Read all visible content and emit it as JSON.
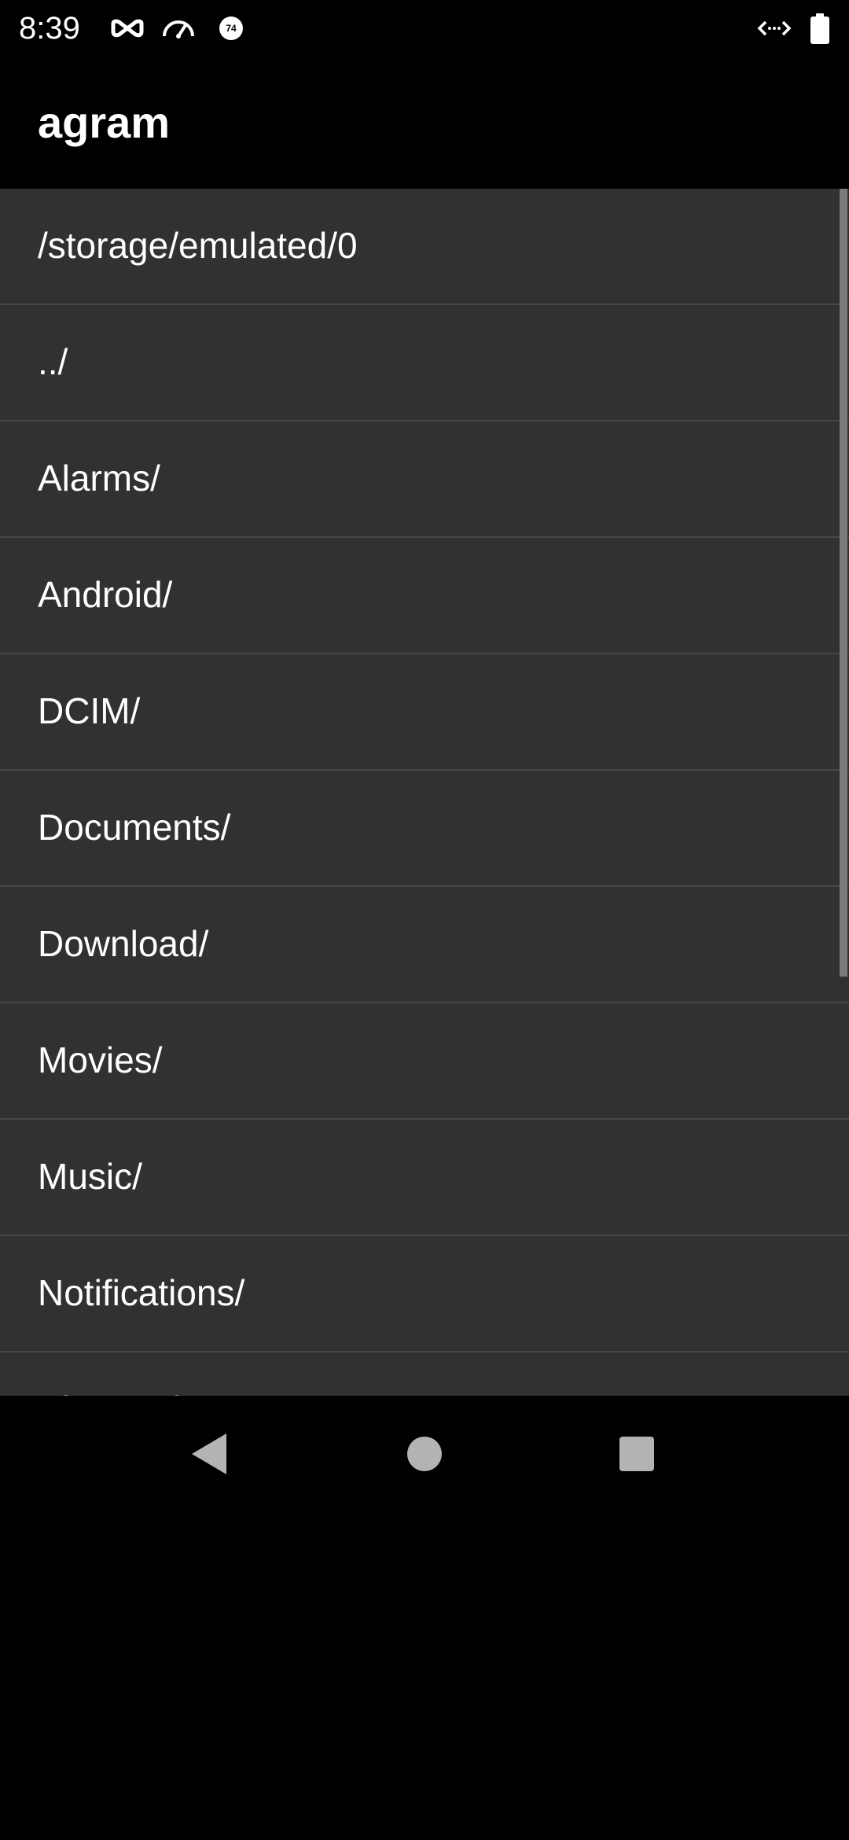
{
  "status_bar": {
    "time": "8:39",
    "icons": [
      "mask-icon",
      "speedometer-icon",
      "badge-74-icon",
      "code-arrows-icon",
      "battery-icon"
    ],
    "badge_number": "74"
  },
  "app_bar": {
    "title": "agram"
  },
  "list": {
    "items": [
      {
        "label": "/storage/emulated/0"
      },
      {
        "label": "../"
      },
      {
        "label": "Alarms/"
      },
      {
        "label": "Android/"
      },
      {
        "label": "DCIM/"
      },
      {
        "label": "Documents/"
      },
      {
        "label": "Download/"
      },
      {
        "label": "Movies/"
      },
      {
        "label": "Music/"
      },
      {
        "label": "Notifications/"
      },
      {
        "label": "Pictures/"
      }
    ]
  },
  "nav_bar": {
    "buttons": [
      "back-icon",
      "home-icon",
      "recents-icon"
    ]
  },
  "colors": {
    "background": "#000000",
    "list_background": "#313131",
    "divider": "#474747",
    "text": "#ffffff",
    "scrollbar": "#7a7a7a"
  }
}
